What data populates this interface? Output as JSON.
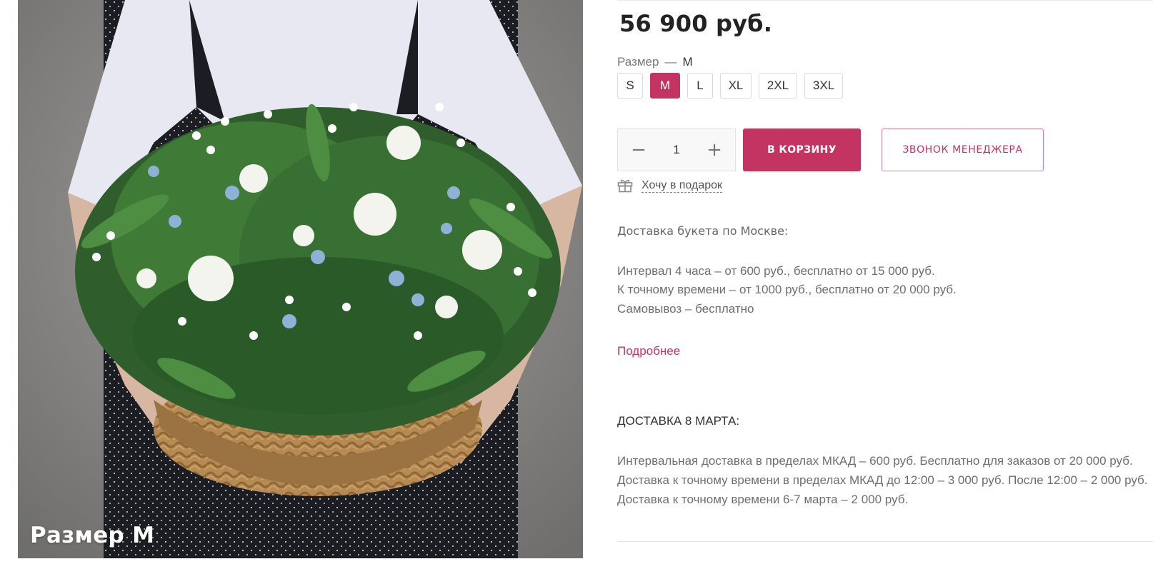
{
  "product": {
    "price": "56 900 руб.",
    "image_caption": "Размер M",
    "image_alt": "Корзина с ландышами и белыми и голубыми цветами"
  },
  "size_selector": {
    "label": "Размер",
    "dash": "—",
    "selected": "M",
    "options": [
      "S",
      "M",
      "L",
      "XL",
      "2XL",
      "3XL"
    ]
  },
  "quantity": {
    "minus": "−",
    "value": "1",
    "plus": "+"
  },
  "buttons": {
    "add_to_cart": "В КОРЗИНУ",
    "call_manager": "ЗВОНОК МЕНЕДЖЕРА",
    "gift": "Хочу в подарок"
  },
  "delivery": {
    "title": "Доставка букета по Москве:",
    "lines": [
      "Интервал 4 часа – от 600 руб., бесплатно от 15 000 руб.",
      "К точному времени – от 1000 руб., бесплатно от 20 000 руб.",
      "Самовывоз – бесплатно"
    ],
    "more_link": "Подробнее"
  },
  "march_delivery": {
    "title": "ДОСТАВКА 8 МАРТА:",
    "lines": [
      "Интервальная доставка в пределах МКАД – 600 руб. Бесплатно для заказов от 20 000 руб.",
      "Доставка к точному времени  в пределах МКАД  до 12:00 – 3 000 руб. После 12:00 – 2 000 руб.",
      "Доставка к точному времени 6-7 марта – 2 000 руб."
    ]
  },
  "colors": {
    "accent": "#c43462",
    "text": "#333333",
    "muted": "#6e6e6e"
  }
}
